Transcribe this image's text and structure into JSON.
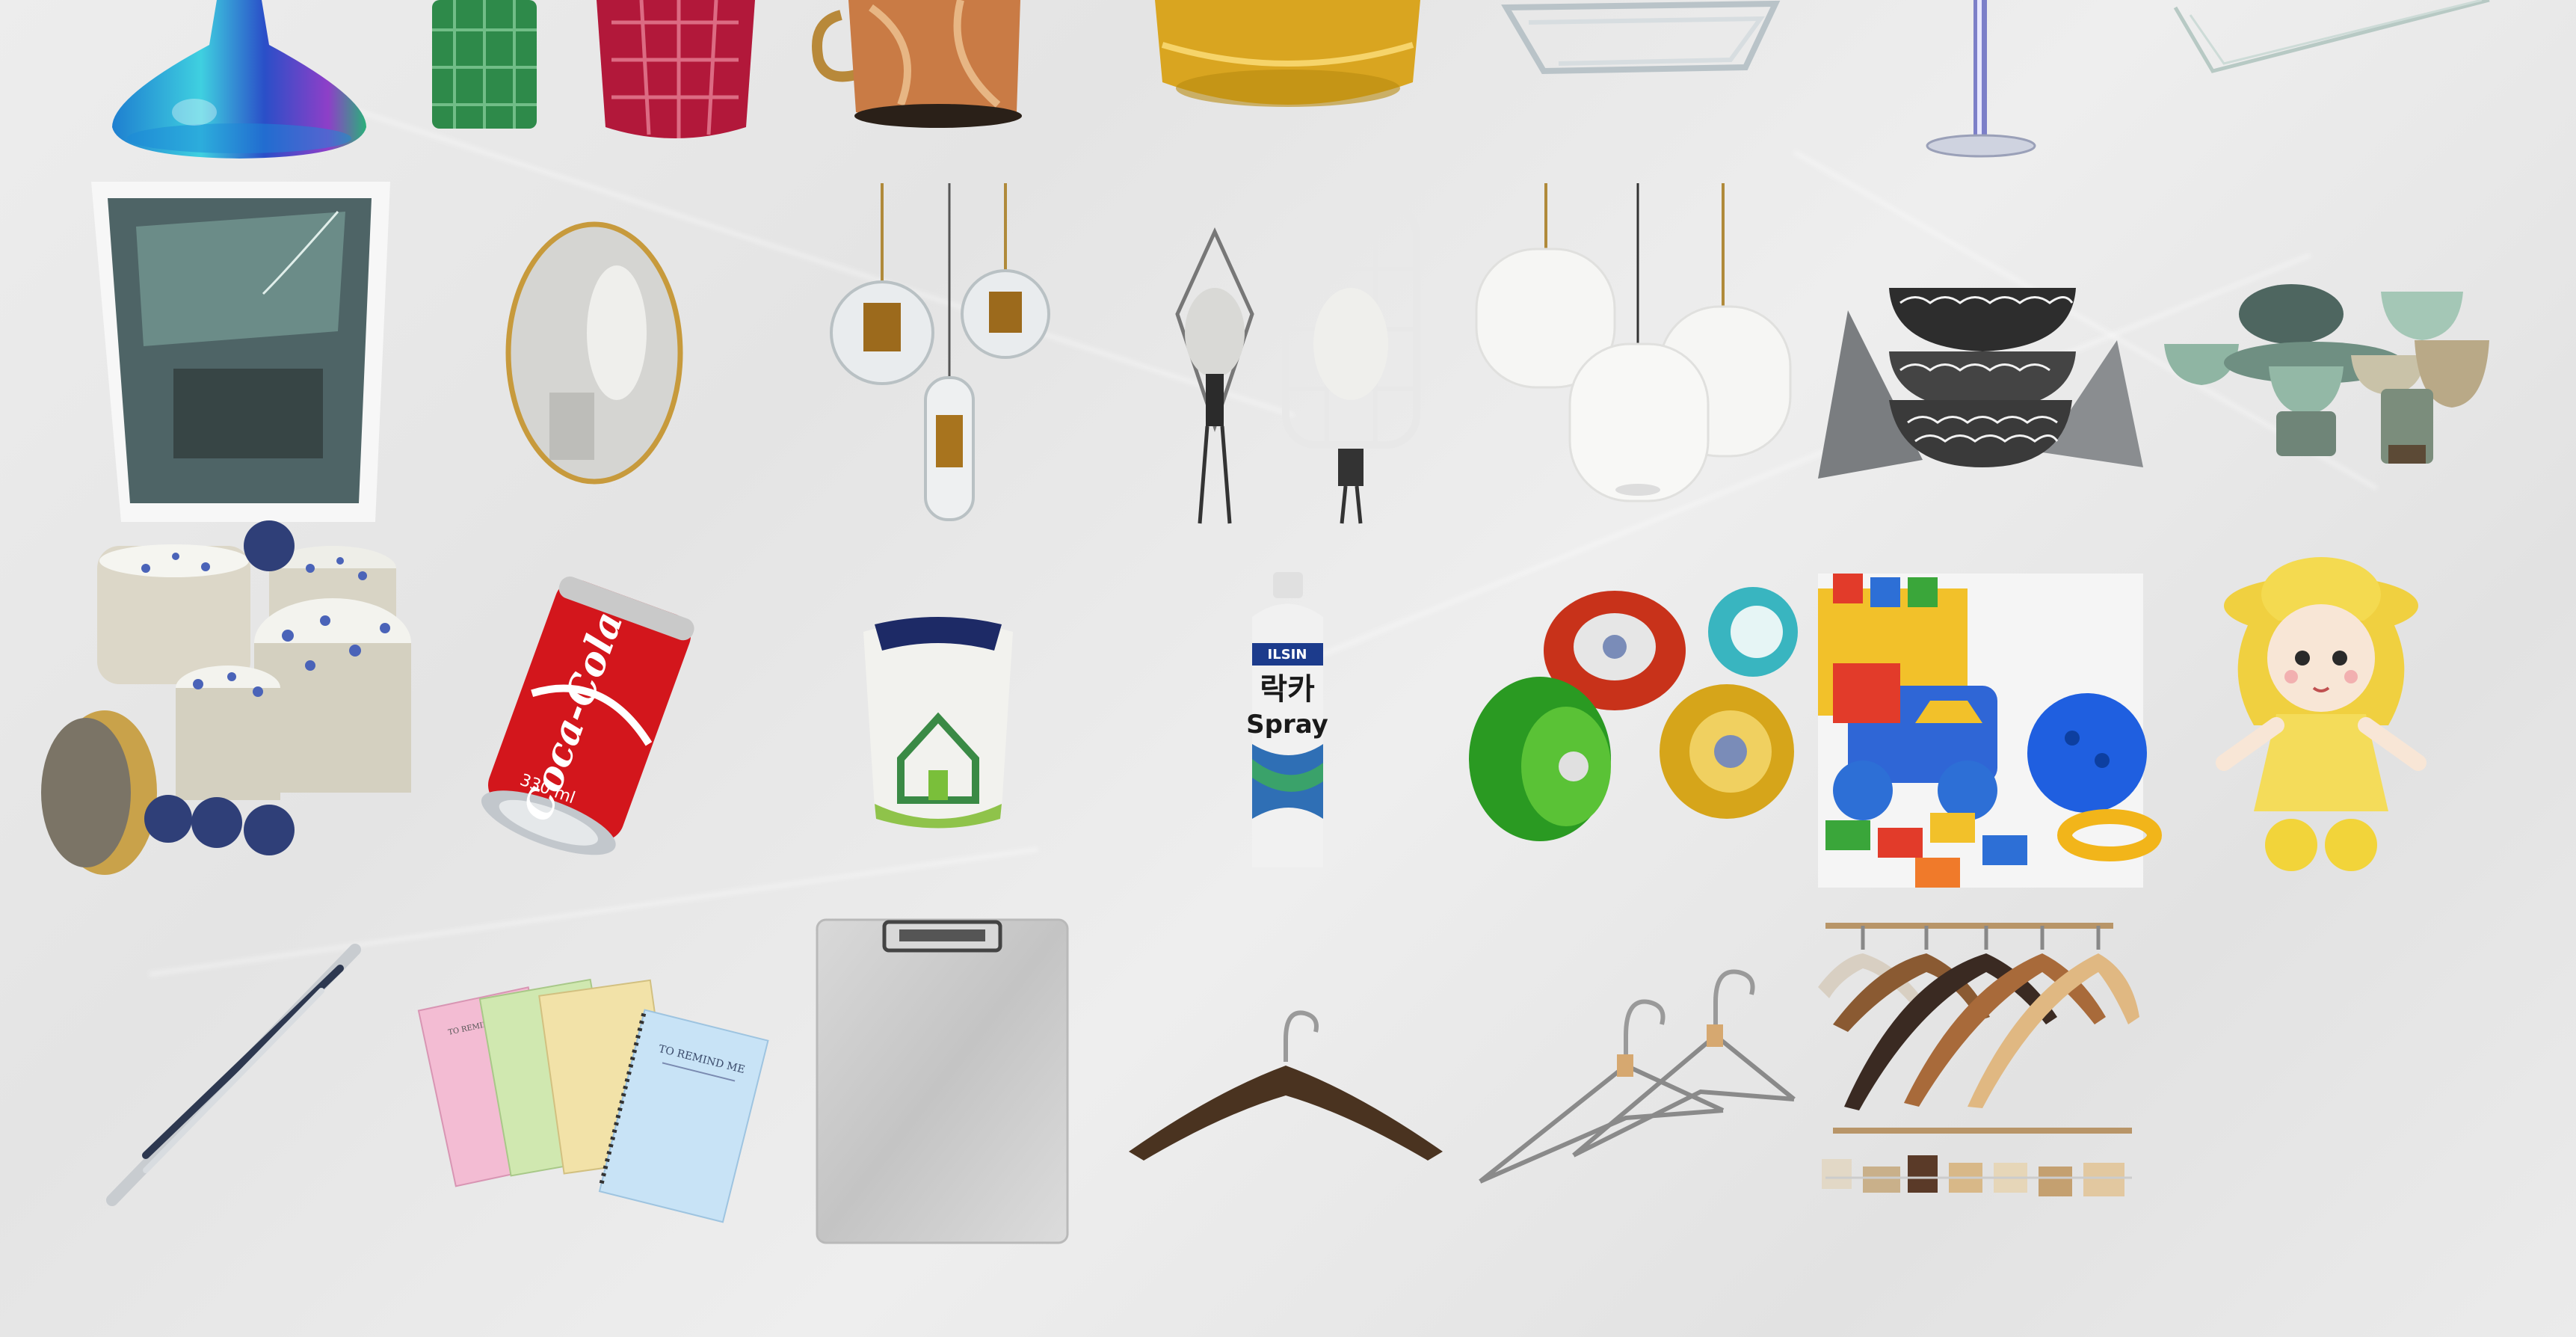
{
  "page": {
    "background": "#e9e9e9"
  },
  "products": {
    "soda_can": {
      "brand": "Coca-Cola",
      "volume": "330 ml"
    },
    "spray_can": {
      "brand": "ILSIN",
      "label_ko": "락카",
      "label_en": "Spray"
    },
    "notebooks": {
      "cover_text": "TO REMIND ME"
    }
  },
  "items": [
    {
      "id": "iridescent-vase",
      "icon": "iridescent-vase-icon"
    },
    {
      "id": "cut-glass-cups",
      "icon": "cut-glass-cups-icon"
    },
    {
      "id": "copper-mug",
      "icon": "copper-mug-icon"
    },
    {
      "id": "amber-glass-bowl",
      "icon": "amber-glass-bowl-icon"
    },
    {
      "id": "glass-baking-dish",
      "icon": "glass-dish-icon"
    },
    {
      "id": "wine-glass",
      "icon": "wine-glass-icon"
    },
    {
      "id": "glass-pane",
      "icon": "glass-pane-icon"
    },
    {
      "id": "framed-mirror",
      "icon": "framed-mirror-icon"
    },
    {
      "id": "oval-mirror",
      "icon": "oval-mirror-icon"
    },
    {
      "id": "glass-pendant-lamps",
      "icon": "pendant-lamps-icon"
    },
    {
      "id": "cage-lamps",
      "icon": "cage-lamps-icon"
    },
    {
      "id": "white-pendant-lamps",
      "icon": "white-lamps-icon"
    },
    {
      "id": "patterned-bowls",
      "icon": "patterned-bowls-icon"
    },
    {
      "id": "green-ceramics",
      "icon": "green-ceramics-icon"
    },
    {
      "id": "blue-floral-plates",
      "icon": "floral-plates-icon"
    },
    {
      "id": "soda-can",
      "icon": "soda-can-icon"
    },
    {
      "id": "paper-cup-pack",
      "icon": "paper-cups-icon"
    },
    {
      "id": "spray-can",
      "icon": "spray-can-icon"
    },
    {
      "id": "metal-yoyos",
      "icon": "yoyos-icon"
    },
    {
      "id": "plastic-toys",
      "icon": "plastic-toys-icon"
    },
    {
      "id": "yellow-doll",
      "icon": "doll-icon"
    },
    {
      "id": "pens",
      "icon": "pens-icon"
    },
    {
      "id": "spiral-notebooks",
      "icon": "notebooks-icon"
    },
    {
      "id": "clipboard",
      "icon": "clipboard-icon"
    },
    {
      "id": "wood-hanger",
      "icon": "hanger-icon"
    },
    {
      "id": "wire-hangers",
      "icon": "wire-hangers-icon"
    },
    {
      "id": "hanger-rack",
      "icon": "hanger-rack-icon"
    }
  ]
}
